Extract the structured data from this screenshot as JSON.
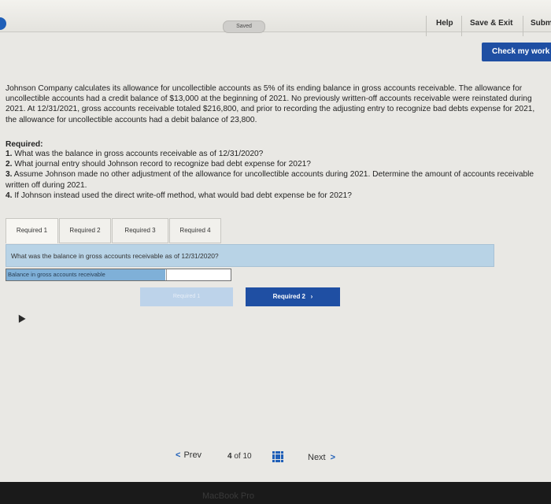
{
  "header": {
    "saved_label": "Saved",
    "help_label": "Help",
    "save_exit_label": "Save & Exit",
    "submit_label": "Subm"
  },
  "check_work_label": "Check my work",
  "problem_text": "Johnson Company calculates its allowance for uncollectible accounts as 5% of its ending balance in gross accounts receivable. The allowance for uncollectible accounts had a credit balance of $13,000 at the beginning of 2021. No previously written-off accounts receivable were reinstated during 2021. At 12/31/2021, gross accounts receivable totaled $216,800, and prior to recording the adjusting entry to recognize bad debts expense for 2021, the allowance for uncollectible accounts had a debit balance of 23,800.",
  "required_heading": "Required:",
  "questions": [
    {
      "num": "1.",
      "text": "What was the balance in gross accounts receivable as of 12/31/2020?"
    },
    {
      "num": "2.",
      "text": "What journal entry should Johnson record to recognize bad debt expense for 2021?"
    },
    {
      "num": "3.",
      "text": "Assume Johnson made no other adjustment of the allowance for uncollectible accounts during 2021. Determine the amount of accounts receivable written off during 2021."
    },
    {
      "num": "4.",
      "text": "If Johnson instead used the direct write-off method, what would bad debt expense be for 2021?"
    }
  ],
  "tabs": [
    {
      "label": "Required 1"
    },
    {
      "label": "Required 2"
    },
    {
      "label": "Required 3"
    },
    {
      "label": "Required 4"
    }
  ],
  "current_question": "What was the balance in gross accounts receivable as of 12/31/2020?",
  "answer": {
    "label": "Balance in gross accounts receivable",
    "value": ""
  },
  "nav_buttons": {
    "prev_required": "Required 1",
    "next_required": "Required 2"
  },
  "bottom_nav": {
    "prev_label": "Prev",
    "current_page": "4",
    "of_label": "of",
    "total_pages": "10",
    "next_label": "Next"
  },
  "bezel_text": "MacBook Pro",
  "colors": {
    "accent": "#1f4fa3",
    "question_bar": "#b8d3e6",
    "answer_label_bg": "#7fb0d8"
  }
}
